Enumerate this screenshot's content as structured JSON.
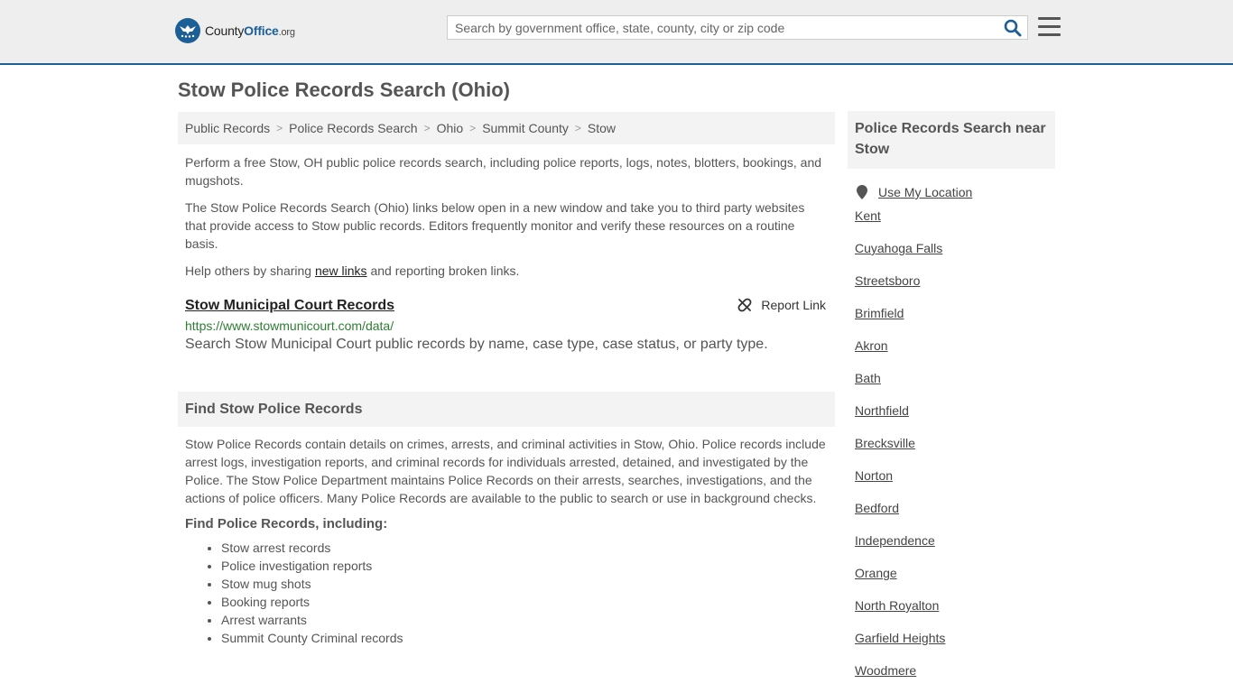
{
  "header": {
    "logo": {
      "name": "County",
      "name_bold": "Office",
      "suffix": ".org"
    },
    "search_placeholder": "Search by government office, state, county, city or zip code"
  },
  "page_title": "Stow Police Records Search (Ohio)",
  "breadcrumb": [
    "Public Records",
    "Police Records Search",
    "Ohio",
    "Summit County",
    "Stow"
  ],
  "intro": {
    "p1": "Perform a free Stow, OH public police records search, including police reports, logs, notes, blotters, bookings, and mugshots.",
    "p2": "The Stow Police Records Search (Ohio) links below open in a new window and take you to third party websites that provide access to Stow public records. Editors frequently monitor and verify these resources on a routine basis.",
    "p3_before": "Help others by sharing ",
    "p3_link": "new links",
    "p3_after": " and reporting broken links."
  },
  "record": {
    "title": "Stow Municipal Court Records",
    "report_label": "Report Link",
    "url": "https://www.stowmunicourt.com/data/",
    "description": "Search Stow Municipal Court public records by name, case type, case status, or party type."
  },
  "find_section": {
    "heading": "Find Stow Police Records",
    "paragraph": "Stow Police Records contain details on crimes, arrests, and criminal activities in Stow, Ohio. Police records include arrest logs, investigation reports, and criminal records for individuals arrested, detained, and investigated by the Police. The Stow Police Department maintains Police Records on their arrests, searches, investigations, and the actions of police officers. Many Police Records are available to the public to search or use in background checks.",
    "sub_heading": "Find Police Records, including:",
    "items": [
      "Stow arrest records",
      "Police investigation reports",
      "Stow mug shots",
      "Booking reports",
      "Arrest warrants",
      "Summit County Criminal records"
    ]
  },
  "sidebar": {
    "heading": "Police Records Search near Stow",
    "location_label": "Use My Location",
    "cities": [
      "Kent",
      "Cuyahoga Falls",
      "Streetsboro",
      "Brimfield",
      "Akron",
      "Bath",
      "Northfield",
      "Brecksville",
      "Norton",
      "Bedford",
      "Independence",
      "Orange",
      "North Royalton",
      "Garfield Heights",
      "Woodmere"
    ]
  },
  "colors": {
    "brand": "#1c5f97",
    "url_green": "#2e7d32"
  }
}
